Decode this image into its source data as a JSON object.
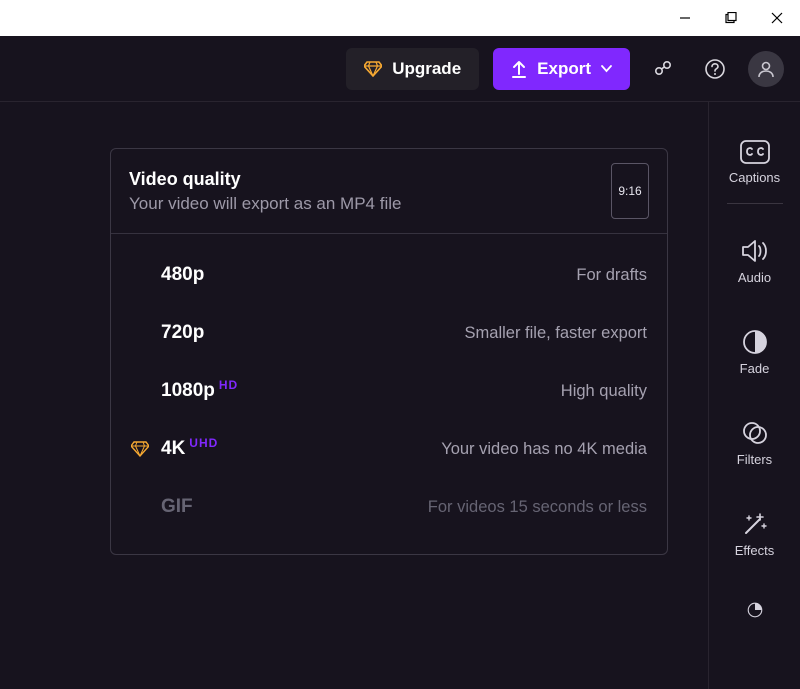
{
  "toolbar": {
    "upgrade_label": "Upgrade",
    "export_label": "Export"
  },
  "export_panel": {
    "title": "Video quality",
    "subtitle": "Your video will export as an MP4 file",
    "aspect_ratio": "9:16",
    "options": [
      {
        "name": "480p",
        "badge": "",
        "desc": "For drafts",
        "premium": false,
        "disabled": false
      },
      {
        "name": "720p",
        "badge": "",
        "desc": "Smaller file, faster export",
        "premium": false,
        "disabled": false
      },
      {
        "name": "1080p",
        "badge": "HD",
        "desc": "High quality",
        "premium": false,
        "disabled": false
      },
      {
        "name": "4K",
        "badge": "UHD",
        "desc": "Your video has no 4K media",
        "premium": true,
        "disabled": false
      },
      {
        "name": "GIF",
        "badge": "",
        "desc": "For videos 15 seconds or less",
        "premium": false,
        "disabled": true
      }
    ]
  },
  "sidebar": {
    "items": [
      {
        "label": "Captions"
      },
      {
        "label": "Audio"
      },
      {
        "label": "Fade"
      },
      {
        "label": "Filters"
      },
      {
        "label": "Effects"
      }
    ]
  }
}
